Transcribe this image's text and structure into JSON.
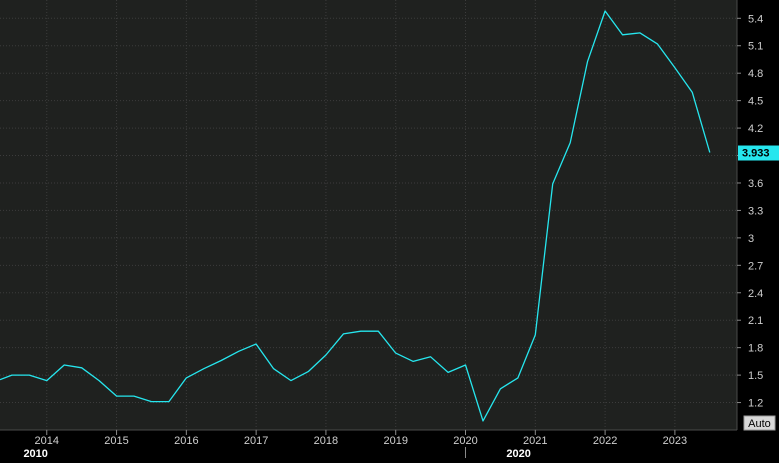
{
  "chart_data": {
    "type": "line",
    "title": "",
    "xlabel": "",
    "ylabel": "",
    "grid": true,
    "ylim": [
      0.9,
      5.6
    ],
    "xlim": [
      2013.33,
      2023.89
    ],
    "y_ticks": [
      {
        "value": 5.4,
        "label": "5.4"
      },
      {
        "value": 5.1,
        "label": "5.1"
      },
      {
        "value": 4.8,
        "label": "4.8"
      },
      {
        "value": 4.5,
        "label": "4.5"
      },
      {
        "value": 4.2,
        "label": "4.2"
      },
      {
        "value": 3.9,
        "label": "3.9"
      },
      {
        "value": 3.6,
        "label": "3.6"
      },
      {
        "value": 3.3,
        "label": "3.3"
      },
      {
        "value": 3.0,
        "label": "3"
      },
      {
        "value": 2.7,
        "label": "2.7"
      },
      {
        "value": 2.4,
        "label": "2.4"
      },
      {
        "value": 2.1,
        "label": "2.1"
      },
      {
        "value": 1.8,
        "label": "1.8"
      },
      {
        "value": 1.5,
        "label": "1.5"
      },
      {
        "value": 1.2,
        "label": "1.2"
      }
    ],
    "x_ticks": [
      {
        "value": 2014,
        "label": "2014"
      },
      {
        "value": 2015,
        "label": "2015"
      },
      {
        "value": 2016,
        "label": "2016"
      },
      {
        "value": 2017,
        "label": "2017"
      },
      {
        "value": 2018,
        "label": "2018"
      },
      {
        "value": 2019,
        "label": "2019"
      },
      {
        "value": 2020,
        "label": "2020"
      },
      {
        "value": 2021,
        "label": "2021"
      },
      {
        "value": 2022,
        "label": "2022"
      },
      {
        "value": 2023,
        "label": "2023"
      }
    ],
    "major_labels": [
      {
        "value": 2010,
        "label": "2010",
        "position": 2013.58
      },
      {
        "value": 2020,
        "label": "2020",
        "position": 2020.5
      }
    ],
    "series": [
      {
        "color": "#26e6ee",
        "x": [
          2013.33,
          2013.5,
          2013.75,
          2014.0,
          2014.25,
          2014.5,
          2014.75,
          2015.0,
          2015.25,
          2015.5,
          2015.75,
          2016.0,
          2016.25,
          2016.5,
          2016.75,
          2017.0,
          2017.25,
          2017.5,
          2017.75,
          2018.0,
          2018.25,
          2018.5,
          2018.75,
          2019.0,
          2019.25,
          2019.5,
          2019.75,
          2020.0,
          2020.25,
          2020.5,
          2020.75,
          2021.0,
          2021.25,
          2021.5,
          2021.75,
          2022.0,
          2022.25,
          2022.5,
          2022.75,
          2023.0,
          2023.25,
          2023.5
        ],
        "values": [
          1.45,
          1.5,
          1.5,
          1.44,
          1.61,
          1.58,
          1.44,
          1.27,
          1.27,
          1.21,
          1.21,
          1.47,
          1.57,
          1.66,
          1.76,
          1.84,
          1.57,
          1.44,
          1.54,
          1.72,
          1.95,
          1.98,
          1.98,
          1.74,
          1.65,
          1.7,
          1.53,
          1.61,
          1.0,
          1.35,
          1.47,
          1.94,
          3.59,
          4.04,
          4.93,
          5.48,
          5.22,
          5.24,
          5.12,
          4.86,
          4.59,
          3.933
        ]
      }
    ],
    "last_value": "3.933",
    "last_value_color": "#26e6ee"
  },
  "controls": {
    "auto_label": "Auto"
  },
  "colors": {
    "background": "#000000",
    "plot_background": "#1f211f",
    "axis_background": "#000000",
    "line": "#26e6ee"
  }
}
